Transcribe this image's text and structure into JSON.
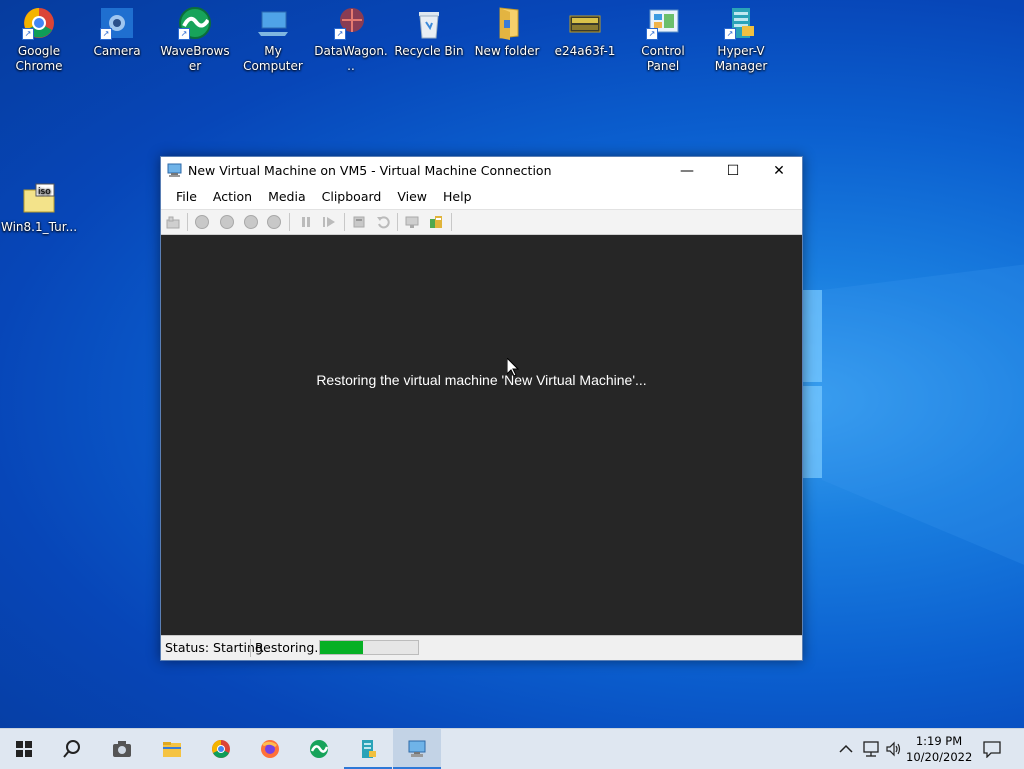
{
  "desktop": {
    "icons": [
      {
        "label": "Google Chrome"
      },
      {
        "label": "Camera"
      },
      {
        "label": "WaveBrowser"
      },
      {
        "label": "My Computer"
      },
      {
        "label": "DataWagon..."
      },
      {
        "label": "Recycle Bin"
      },
      {
        "label": "New folder"
      },
      {
        "label": "e24a63f-1"
      },
      {
        "label": "Control Panel"
      },
      {
        "label": "Hyper-V Manager"
      },
      {
        "label": "Win8.1_Tur..."
      }
    ]
  },
  "window": {
    "title": "New Virtual Machine on VM5 - Virtual Machine Connection",
    "minimize_glyph": "—",
    "maximize_glyph": "☐",
    "close_glyph": "✕",
    "menu": [
      "File",
      "Action",
      "Media",
      "Clipboard",
      "View",
      "Help"
    ],
    "message": "Restoring the virtual machine 'New Virtual Machine'...",
    "status": "Status: Starting",
    "status_detail": "Restoring...",
    "progress_fraction": 0.44
  },
  "taskbar": {
    "items": [
      "start",
      "search",
      "camera",
      "file-explorer",
      "chrome",
      "firefox",
      "wavebrowser",
      "hyperv-manager",
      "vm-connection"
    ],
    "clock_time": "1:19 PM",
    "clock_date": "10/20/2022"
  },
  "colors": {
    "accent": "#2e78d7",
    "progress": "#06b025",
    "viewport": "#262626"
  }
}
